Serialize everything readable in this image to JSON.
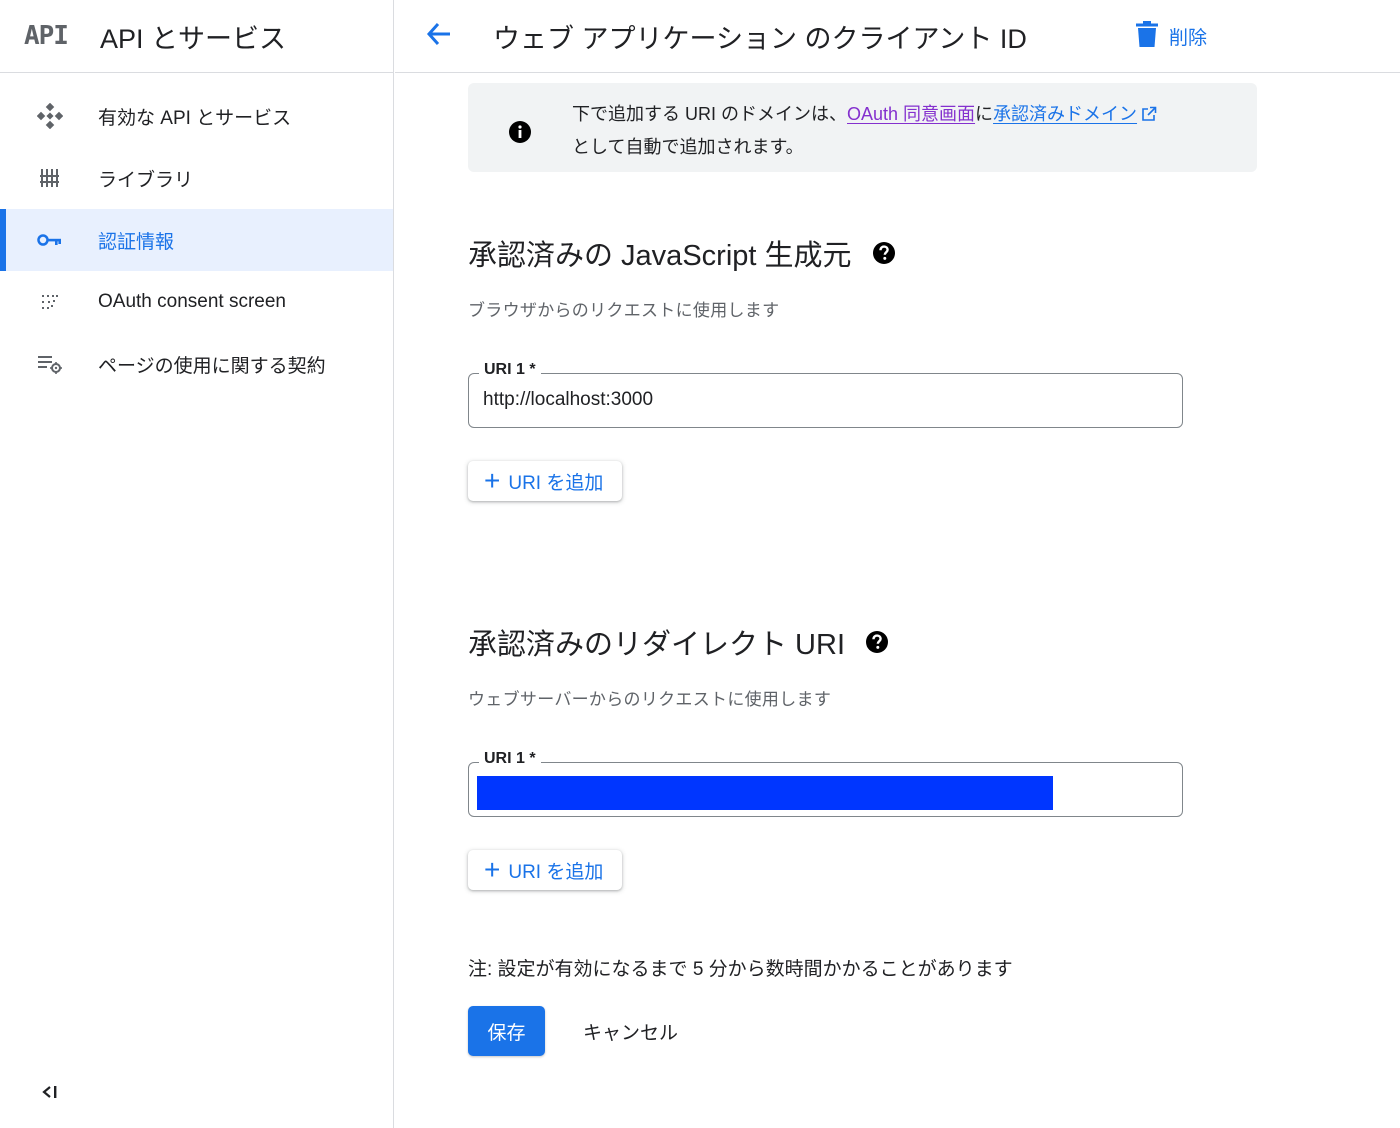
{
  "sidebar": {
    "logo_text": "API",
    "title": "API とサービス",
    "items": [
      {
        "label": "有効な API とサービス",
        "icon": "api-diamond-icon"
      },
      {
        "label": "ライブラリ",
        "icon": "library-icon"
      },
      {
        "label": "認証情報",
        "icon": "key-icon",
        "active": true
      },
      {
        "label": "OAuth consent screen",
        "icon": "consent-dots-icon"
      },
      {
        "label": "ページの使用に関する契約",
        "icon": "settings-list-icon"
      }
    ],
    "collapse_icon": "collapse-sidebar-icon"
  },
  "topbar": {
    "back_icon": "arrow-back-icon",
    "title": "ウェブ アプリケーション のクライアント ID",
    "delete_label": "削除",
    "delete_icon": "trash-icon"
  },
  "info": {
    "text_part1": "下で追加する URI のドメインは、",
    "link1": "OAuth 同意画面",
    "text_part2": "に",
    "link2": "承認済みドメイン",
    "text_part3": "として自動で追加されます。"
  },
  "js_origins": {
    "title": "承認済みの JavaScript 生成元",
    "subtitle": "ブラウザからのリクエストに使用します",
    "field_label": "URI 1 *",
    "field_value": "http://localhost:3000",
    "add_label": "URI を追加"
  },
  "redirect_uris": {
    "title": "承認済みのリダイレクト URI",
    "subtitle": "ウェブサーバーからのリクエストに使用します",
    "field_label": "URI 1 *",
    "add_label": "URI を追加"
  },
  "note": "注: 設定が有効になるまで 5 分から数時間かかることがあります",
  "actions": {
    "save": "保存",
    "cancel": "キャンセル"
  },
  "colors": {
    "accent": "#1a73e8",
    "visited_link": "#8430ce",
    "redaction": "#0036ff",
    "active_bg": "#e8f0fe"
  }
}
